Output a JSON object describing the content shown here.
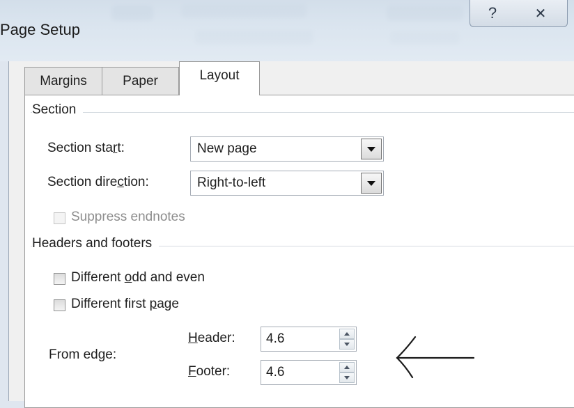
{
  "window": {
    "title": "Page Setup",
    "help_glyph": "?",
    "close_glyph": "✕"
  },
  "tabs": [
    {
      "label": "Margins",
      "active": false
    },
    {
      "label": "Paper",
      "active": false
    },
    {
      "label": "Layout",
      "active": true
    }
  ],
  "section": {
    "heading": "Section",
    "start_label_pre": "Section sta",
    "start_label_u": "r",
    "start_label_post": "t:",
    "start_value": "New page",
    "direction_label_pre": "Section dire",
    "direction_label_u": "c",
    "direction_label_post": "tion:",
    "direction_value": "Right-to-left",
    "suppress_label": "Suppress endnotes",
    "suppress_checked": false,
    "suppress_enabled": false
  },
  "headers_footers": {
    "heading": "Headers and footers",
    "odd_even_pre": "Different ",
    "odd_even_u": "o",
    "odd_even_post": "dd and even",
    "odd_even_checked": false,
    "first_page_pre": "Different first ",
    "first_page_u": "p",
    "first_page_post": "age",
    "first_page_checked": false,
    "from_edge_label": "From edge:",
    "header_label_u": "H",
    "header_label_post": "eader:",
    "header_value": "4.6",
    "footer_label_u": "F",
    "footer_label_post": "ooter:",
    "footer_value": "4.6"
  },
  "annotation": {
    "icon": "left-arrow-icon",
    "color": "#1a1a1a"
  }
}
